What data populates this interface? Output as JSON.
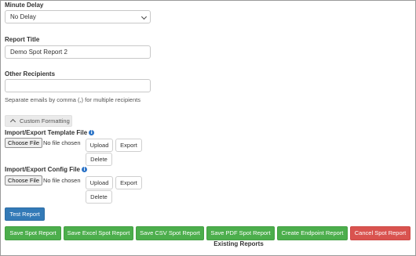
{
  "minute_delay": {
    "label": "Minute Delay",
    "selected": "No Delay"
  },
  "report_title": {
    "label": "Report Title",
    "value": "Demo Spot Report 2"
  },
  "other_recipients": {
    "label": "Other Recipients",
    "value": "",
    "help": "Separate emails by comma (,) for multiple recipients"
  },
  "custom_formatting": {
    "label": "Custom Formatting"
  },
  "template_file": {
    "label": "Import/Export Template File",
    "choose_label": "Choose File",
    "status": "No file chosen",
    "upload_label": "Upload",
    "export_label": "Export",
    "delete_label": "Delete"
  },
  "config_file": {
    "label": "Import/Export Config File",
    "choose_label": "Choose File",
    "status": "No file chosen",
    "upload_label": "Upload",
    "export_label": "Export",
    "delete_label": "Delete"
  },
  "test_report_label": "Test Report",
  "actions": {
    "save_spot": "Save Spot Report",
    "save_excel": "Save Excel Spot Report",
    "save_csv": "Save CSV Spot Report",
    "save_pdf": "Save PDF Spot Report",
    "create_endpoint": "Create Endpoint Report",
    "cancel": "Cancel Spot Report"
  },
  "existing_reports_label": "Existing Reports",
  "info_icon_glyph": "i",
  "colors": {
    "save_button": "#4cae4c",
    "cancel_button": "#d9534f",
    "test_button": "#337ab7",
    "info_icon": "#2a73c7"
  }
}
